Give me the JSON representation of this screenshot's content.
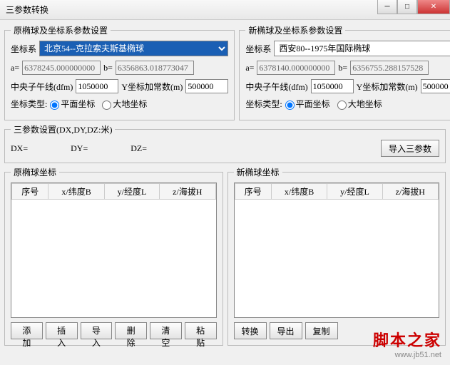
{
  "window": {
    "title": "三参数转换"
  },
  "src": {
    "legend": "原椭球及坐标系参数设置",
    "coord_label": "坐标系",
    "coord_value": "北京54--克拉索夫斯基椭球",
    "a_label": "a=",
    "a_value": "6378245.000000000",
    "b_label": "b=",
    "b_value": "6356863.018773047",
    "meridian_label": "中央子午线(dfm)",
    "meridian_value": "1050000",
    "yconst_label": "Y坐标加常数(m)",
    "yconst_value": "500000",
    "type_label": "坐标类型:",
    "type_plane": "平面坐标",
    "type_geod": "大地坐标"
  },
  "dst": {
    "legend": "新椭球及坐标系参数设置",
    "coord_label": "坐标系",
    "coord_value": "西安80--1975年国际椭球",
    "a_label": "a=",
    "a_value": "6378140.000000000",
    "b_label": "b=",
    "b_value": "6356755.288157528",
    "meridian_label": "中央子午线(dfm)",
    "meridian_value": "1050000",
    "yconst_label": "Y坐标加常数(m)",
    "yconst_value": "500000",
    "type_label": "坐标类型:",
    "type_plane": "平面坐标",
    "type_geod": "大地坐标"
  },
  "param3": {
    "legend": "三参数设置(DX,DY,DZ:米)",
    "dx": "DX=",
    "dy": "DY=",
    "dz": "DZ=",
    "import": "导入三参数"
  },
  "table_src": {
    "legend": "原椭球坐标",
    "cols": [
      "序号",
      "x/纬度B",
      "y/经度L",
      "z/海拔H"
    ],
    "btns": [
      "添加",
      "插入",
      "导入",
      "删除",
      "清空",
      "粘贴"
    ]
  },
  "table_dst": {
    "legend": "新椭球坐标",
    "cols": [
      "序号",
      "x/纬度B",
      "y/经度L",
      "z/海拔H"
    ],
    "btns": [
      "转换",
      "导出",
      "复制"
    ]
  },
  "watermark": {
    "text": "脚本之家",
    "url": "www.jb51.net"
  }
}
